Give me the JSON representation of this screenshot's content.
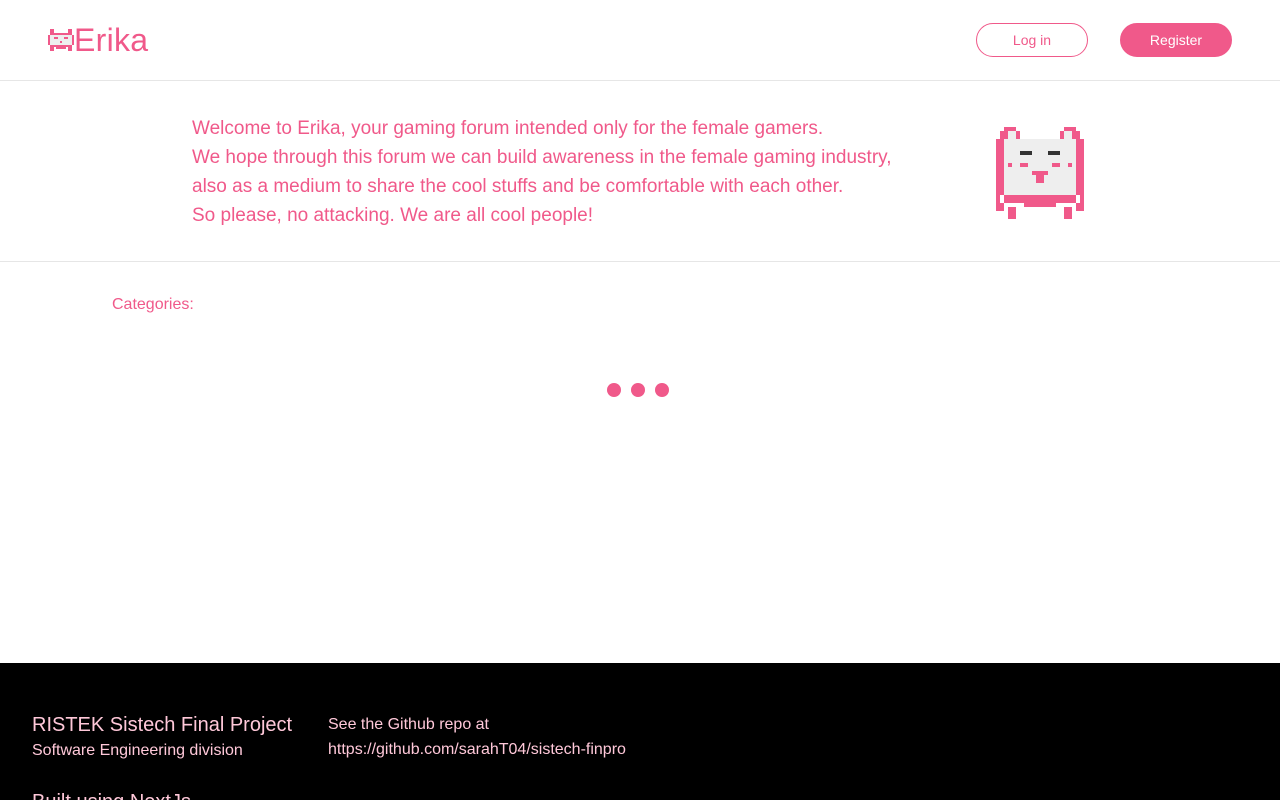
{
  "header": {
    "brand_name": "Erika",
    "login_label": "Log in",
    "register_label": "Register"
  },
  "welcome": {
    "lines": [
      "Welcome to Erika, your gaming forum intended only for the female gamers.",
      "We hope through this forum we can build awareness in the female gaming industry,",
      "also as a medium to share the cool stuffs and be comfortable with each other.",
      "So please, no attacking. We are all cool people!"
    ],
    "mascot_icon": "pixel-cat-icon"
  },
  "main": {
    "categories_label": "Categories:",
    "loading_icon": "loading-dots-icon"
  },
  "footer": {
    "project_title": "RISTEK Sistech Final Project",
    "division": "Software Engineering division",
    "repo_intro": "See the Github repo at",
    "repo_link": "https://github.com/sarahT04/sistech-finpro",
    "built_using": "Built using NextJs"
  },
  "colors": {
    "accent": "#f0598a",
    "footer_bg": "#000000",
    "footer_text": "#ffc8d9"
  }
}
